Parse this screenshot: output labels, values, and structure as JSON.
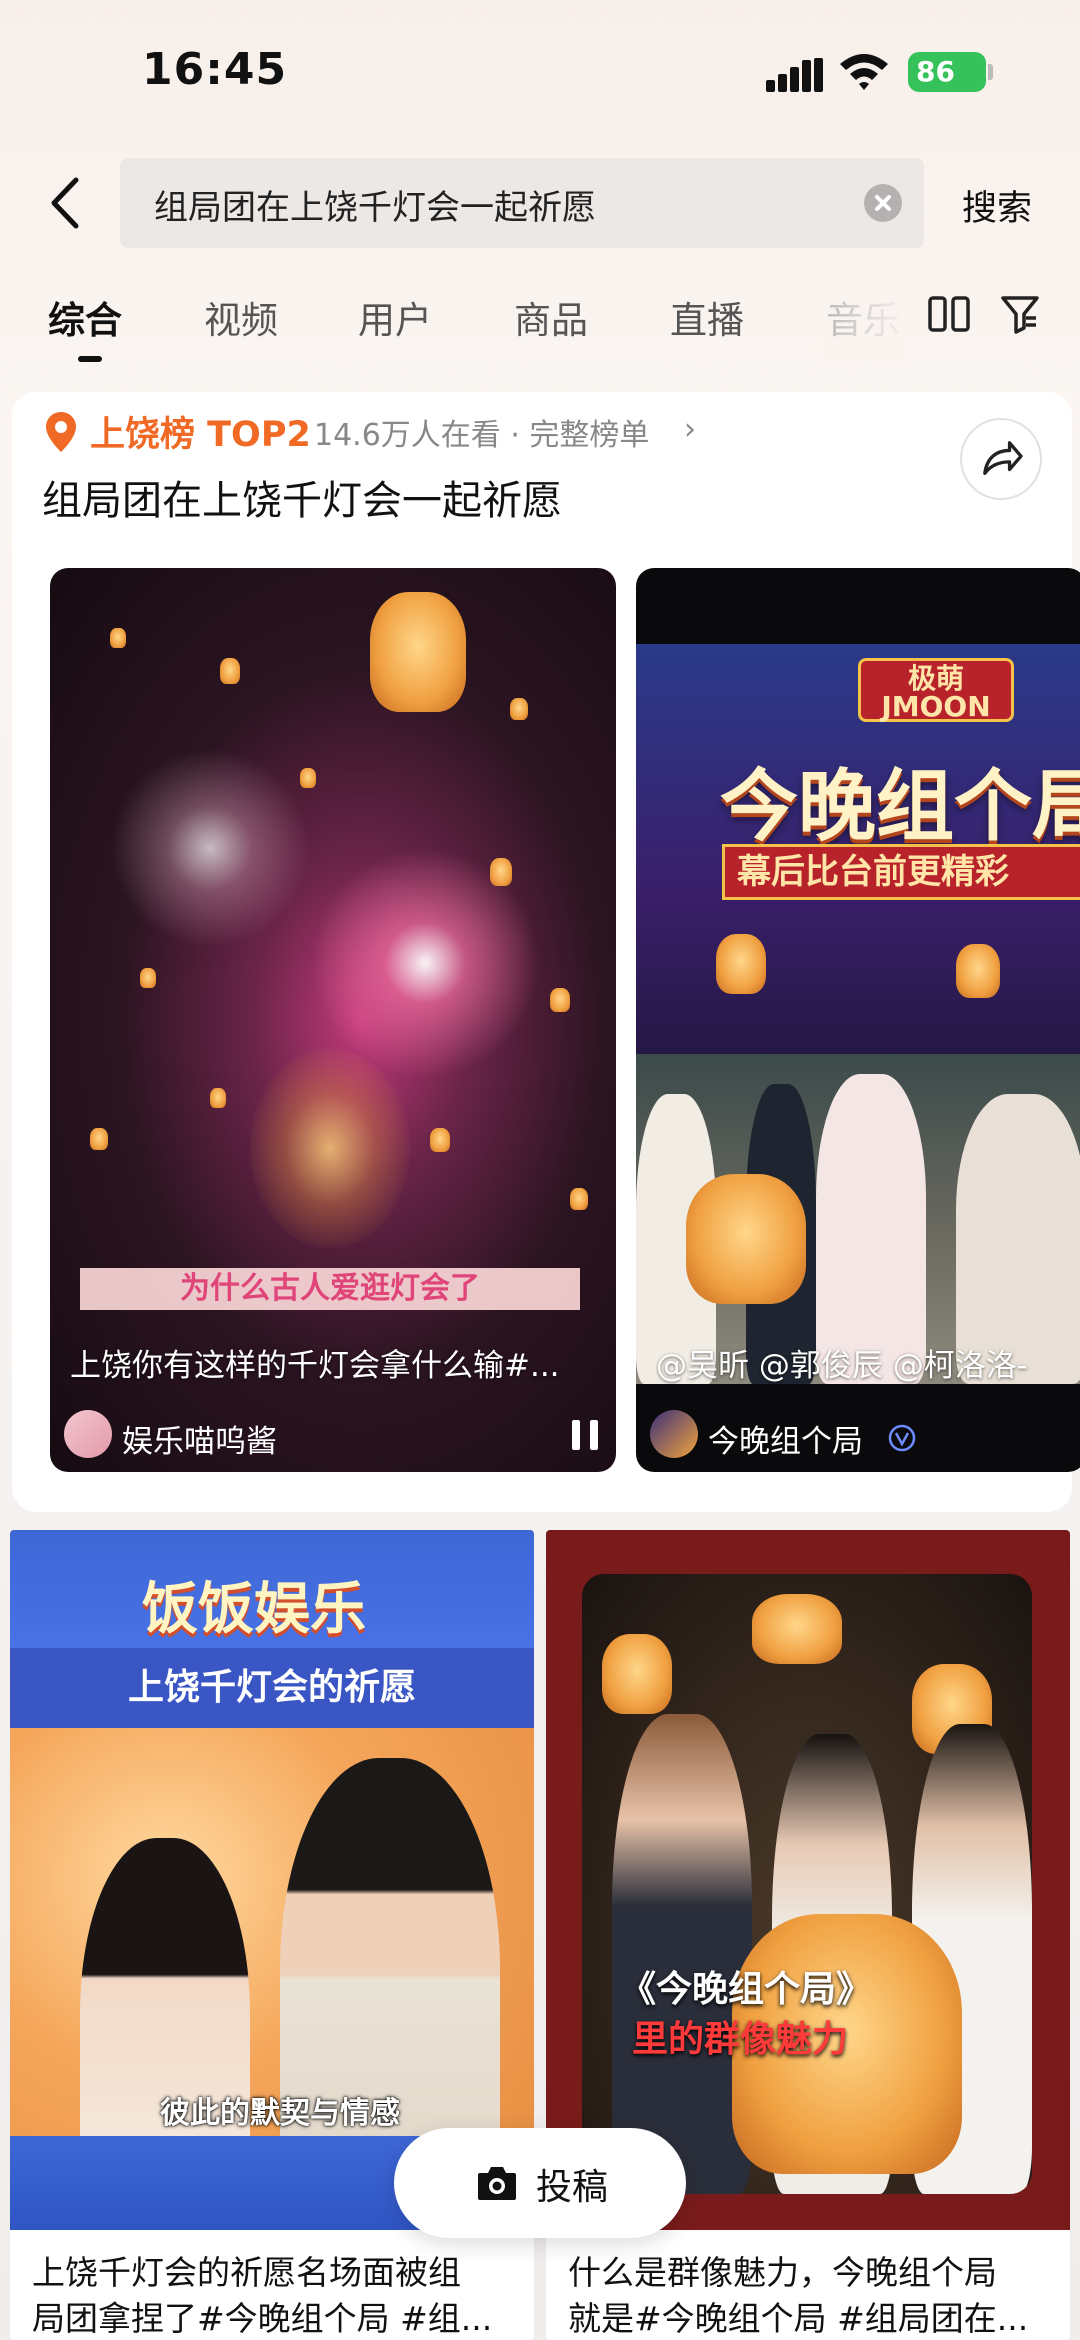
{
  "status_bar": {
    "time": "16:45",
    "battery": "86"
  },
  "search": {
    "query": "组局团在上饶千灯会一起祈愿",
    "button": "搜索"
  },
  "tabs": [
    "综合",
    "视频",
    "用户",
    "商品",
    "直播",
    "音乐"
  ],
  "hot_rank": {
    "name": "上饶榜 TOP2",
    "viewers": "14.6万人在看 · 完整榜单",
    "title": "组局团在上饶千灯会一起祈愿"
  },
  "videos": [
    {
      "overlay_caption": "为什么古人爱逛灯会了",
      "title": "上饶你有这样的千灯会拿什么输#...",
      "author": "娱乐喵呜酱"
    },
    {
      "brand": "极萌 JMOON",
      "headline": "今晚组个局",
      "subhead": "幕后比台前更精彩",
      "title": "@吴昕 @郭俊辰 @柯洛洛-",
      "author": "今晚组个局"
    }
  ],
  "feed": [
    {
      "logo": "饭饭娱乐",
      "banner": "上饶千灯会的祈愿",
      "subtitle": "彼此的默契与情感",
      "text_line1": "上饶千灯会的祈愿名场面被组",
      "text_line2": "局团拿捏了#今晚组个局 #组..."
    },
    {
      "title_line1": "《今晚组个局》",
      "title_line2": "里的群像魅力",
      "text_line1": "什么是群像魅力，今晚组个局",
      "text_line2": "就是#今晚组个局 #组局团在..."
    }
  ],
  "post_button": "投稿",
  "colors": {
    "accent_orange": "#f06a26",
    "battery_green": "#36c25a"
  }
}
